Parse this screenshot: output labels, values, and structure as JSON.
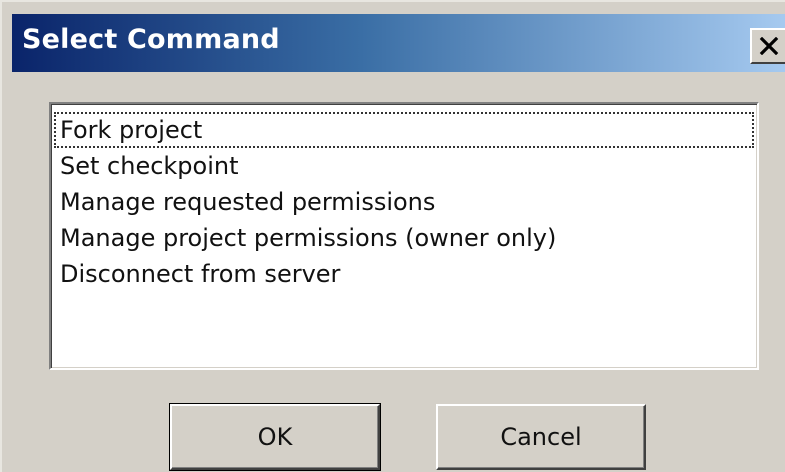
{
  "window": {
    "title": "Select Command",
    "close_icon": "close-icon"
  },
  "commands": {
    "items": [
      {
        "label": "Fork project",
        "selected": true
      },
      {
        "label": "Set checkpoint",
        "selected": false
      },
      {
        "label": "Manage requested permissions",
        "selected": false
      },
      {
        "label": "Manage project permissions (owner only)",
        "selected": false
      },
      {
        "label": "Disconnect from server",
        "selected": false
      }
    ]
  },
  "buttons": {
    "ok_label": "OK",
    "cancel_label": "Cancel"
  },
  "colors": {
    "titlebar_start": "#0a246a",
    "titlebar_end": "#a6caf0",
    "face": "#d4d0c8",
    "list_background": "#ffffff"
  }
}
